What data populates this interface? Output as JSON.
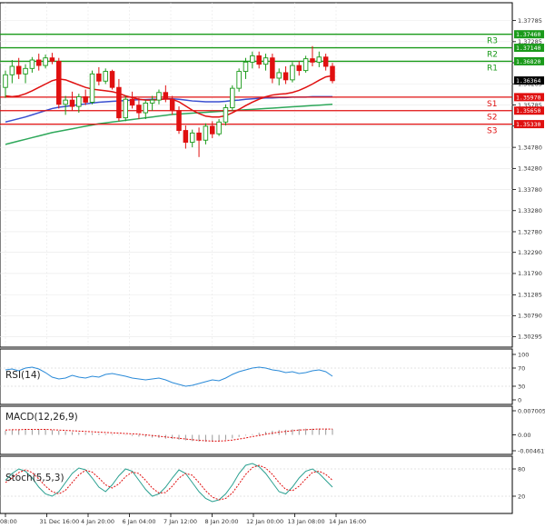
{
  "chart_data": {
    "type": "candlestick",
    "instrument_panel": {
      "y_ticks": [
        "1.37785",
        "1.37285",
        "1.36785",
        "1.36285",
        "1.35785",
        "1.35285",
        "1.34780",
        "1.34280",
        "1.33780",
        "1.33280",
        "1.32780",
        "1.32290",
        "1.31790",
        "1.31285",
        "1.30790",
        "1.30295"
      ],
      "ylim": [
        1.3013,
        1.381
      ],
      "current_price": "1.36364",
      "levels": [
        {
          "name": "R3",
          "value": 1.3746,
          "label": "1.37460",
          "color": "#1a9a1a"
        },
        {
          "name": "R2",
          "value": 1.3714,
          "label": "1.37140",
          "color": "#1a9a1a"
        },
        {
          "name": "R1",
          "value": 1.3682,
          "label": "1.36820",
          "color": "#1a9a1a"
        },
        {
          "name": "S1",
          "value": 1.3597,
          "label": "1.35970",
          "color": "#e01010"
        },
        {
          "name": "S2",
          "value": 1.3565,
          "label": "1.35650",
          "color": "#e01010"
        },
        {
          "name": "S3",
          "value": 1.3533,
          "label": "1.35330",
          "color": "#e01010"
        }
      ],
      "candles": [
        {
          "o": 1.362,
          "h": 1.366,
          "l": 1.3595,
          "c": 1.365
        },
        {
          "o": 1.365,
          "h": 1.3685,
          "l": 1.363,
          "c": 1.367
        },
        {
          "o": 1.367,
          "h": 1.369,
          "l": 1.364,
          "c": 1.3652
        },
        {
          "o": 1.3652,
          "h": 1.3675,
          "l": 1.363,
          "c": 1.3665
        },
        {
          "o": 1.3665,
          "h": 1.3692,
          "l": 1.3655,
          "c": 1.3685
        },
        {
          "o": 1.3685,
          "h": 1.37,
          "l": 1.366,
          "c": 1.3672
        },
        {
          "o": 1.3672,
          "h": 1.3698,
          "l": 1.3665,
          "c": 1.369
        },
        {
          "o": 1.369,
          "h": 1.3702,
          "l": 1.3675,
          "c": 1.3682
        },
        {
          "o": 1.3682,
          "h": 1.369,
          "l": 1.357,
          "c": 1.358
        },
        {
          "o": 1.358,
          "h": 1.36,
          "l": 1.3555,
          "c": 1.359
        },
        {
          "o": 1.359,
          "h": 1.361,
          "l": 1.3565,
          "c": 1.3575
        },
        {
          "o": 1.3575,
          "h": 1.3605,
          "l": 1.356,
          "c": 1.3598
        },
        {
          "o": 1.3598,
          "h": 1.3615,
          "l": 1.3578,
          "c": 1.3585
        },
        {
          "o": 1.3585,
          "h": 1.366,
          "l": 1.358,
          "c": 1.3652
        },
        {
          "o": 1.3652,
          "h": 1.3668,
          "l": 1.3625,
          "c": 1.3635
        },
        {
          "o": 1.3635,
          "h": 1.3665,
          "l": 1.3628,
          "c": 1.3658
        },
        {
          "o": 1.3658,
          "h": 1.3662,
          "l": 1.3615,
          "c": 1.362
        },
        {
          "o": 1.362,
          "h": 1.364,
          "l": 1.354,
          "c": 1.3548
        },
        {
          "o": 1.3548,
          "h": 1.36,
          "l": 1.354,
          "c": 1.3592
        },
        {
          "o": 1.3592,
          "h": 1.361,
          "l": 1.357,
          "c": 1.3578
        },
        {
          "o": 1.3578,
          "h": 1.3595,
          "l": 1.3545,
          "c": 1.356
        },
        {
          "o": 1.356,
          "h": 1.359,
          "l": 1.3545,
          "c": 1.3583
        },
        {
          "o": 1.3583,
          "h": 1.36,
          "l": 1.3565,
          "c": 1.359
        },
        {
          "o": 1.359,
          "h": 1.3615,
          "l": 1.358,
          "c": 1.3608
        },
        {
          "o": 1.3608,
          "h": 1.3625,
          "l": 1.3585,
          "c": 1.3592
        },
        {
          "o": 1.3592,
          "h": 1.36,
          "l": 1.3555,
          "c": 1.3565
        },
        {
          "o": 1.3565,
          "h": 1.3575,
          "l": 1.351,
          "c": 1.3518
        },
        {
          "o": 1.3518,
          "h": 1.353,
          "l": 1.3475,
          "c": 1.349
        },
        {
          "o": 1.349,
          "h": 1.352,
          "l": 1.3478,
          "c": 1.3512
        },
        {
          "o": 1.3512,
          "h": 1.3525,
          "l": 1.3455,
          "c": 1.3495
        },
        {
          "o": 1.3495,
          "h": 1.3535,
          "l": 1.3485,
          "c": 1.3528
        },
        {
          "o": 1.3528,
          "h": 1.354,
          "l": 1.35,
          "c": 1.351
        },
        {
          "o": 1.351,
          "h": 1.3545,
          "l": 1.3505,
          "c": 1.3538
        },
        {
          "o": 1.3538,
          "h": 1.358,
          "l": 1.353,
          "c": 1.3572
        },
        {
          "o": 1.3572,
          "h": 1.3625,
          "l": 1.3565,
          "c": 1.3618
        },
        {
          "o": 1.3618,
          "h": 1.3665,
          "l": 1.361,
          "c": 1.3658
        },
        {
          "o": 1.3658,
          "h": 1.369,
          "l": 1.364,
          "c": 1.368
        },
        {
          "o": 1.368,
          "h": 1.3705,
          "l": 1.3665,
          "c": 1.3695
        },
        {
          "o": 1.3695,
          "h": 1.3705,
          "l": 1.3665,
          "c": 1.3675
        },
        {
          "o": 1.3675,
          "h": 1.37,
          "l": 1.366,
          "c": 1.369
        },
        {
          "o": 1.369,
          "h": 1.37,
          "l": 1.363,
          "c": 1.3642
        },
        {
          "o": 1.3642,
          "h": 1.3665,
          "l": 1.3625,
          "c": 1.3655
        },
        {
          "o": 1.3655,
          "h": 1.367,
          "l": 1.3628,
          "c": 1.3638
        },
        {
          "o": 1.3638,
          "h": 1.368,
          "l": 1.3632,
          "c": 1.3672
        },
        {
          "o": 1.3672,
          "h": 1.3682,
          "l": 1.3648,
          "c": 1.366
        },
        {
          "o": 1.366,
          "h": 1.3695,
          "l": 1.3655,
          "c": 1.3688
        },
        {
          "o": 1.3688,
          "h": 1.3718,
          "l": 1.367,
          "c": 1.368
        },
        {
          "o": 1.368,
          "h": 1.3705,
          "l": 1.3668,
          "c": 1.3692
        },
        {
          "o": 1.3692,
          "h": 1.37,
          "l": 1.366,
          "c": 1.367
        },
        {
          "o": 1.367,
          "h": 1.3678,
          "l": 1.363,
          "c": 1.3636
        }
      ],
      "ma_fast": [
        1.36,
        1.3598,
        1.36,
        1.3605,
        1.3612,
        1.362,
        1.3628,
        1.3636,
        1.364,
        1.3638,
        1.3632,
        1.3626,
        1.362,
        1.3616,
        1.3614,
        1.3612,
        1.361,
        1.3606,
        1.36,
        1.3596,
        1.3592,
        1.359,
        1.359,
        1.3591,
        1.3593,
        1.3592,
        1.3586,
        1.3576,
        1.3566,
        1.3558,
        1.3552,
        1.355,
        1.355,
        1.3553,
        1.356,
        1.3568,
        1.3577,
        1.3585,
        1.3592,
        1.3598,
        1.3602,
        1.3604,
        1.3605,
        1.3608,
        1.3613,
        1.362,
        1.3628,
        1.3637,
        1.3645,
        1.3648
      ],
      "ma_mid": [
        1.3538,
        1.3542,
        1.3546,
        1.355,
        1.3555,
        1.356,
        1.3565,
        1.357,
        1.3573,
        1.3575,
        1.3577,
        1.3579,
        1.3581,
        1.3583,
        1.3585,
        1.3586,
        1.3587,
        1.3588,
        1.3589,
        1.359,
        1.3591,
        1.3591,
        1.3592,
        1.3592,
        1.3593,
        1.3593,
        1.3592,
        1.359,
        1.3588,
        1.3587,
        1.3586,
        1.3586,
        1.3586,
        1.3587,
        1.3589,
        1.359,
        1.3592,
        1.3593,
        1.3594,
        1.3595,
        1.3595,
        1.3596,
        1.3596,
        1.3597,
        1.3597,
        1.3597,
        1.3598,
        1.3598,
        1.3598,
        1.3598
      ],
      "ma_slow": [
        1.3485,
        1.3489,
        1.3493,
        1.3497,
        1.3501,
        1.3505,
        1.3509,
        1.3513,
        1.3516,
        1.3519,
        1.3522,
        1.3525,
        1.3528,
        1.3531,
        1.3534,
        1.3536,
        1.3538,
        1.354,
        1.3542,
        1.3544,
        1.3546,
        1.3548,
        1.355,
        1.3552,
        1.3554,
        1.3556,
        1.3557,
        1.3558,
        1.3559,
        1.356,
        1.3561,
        1.3562,
        1.3563,
        1.3564,
        1.3565,
        1.3566,
        1.3567,
        1.3568,
        1.3569,
        1.357,
        1.3571,
        1.3572,
        1.3573,
        1.3574,
        1.3575,
        1.3576,
        1.3577,
        1.3578,
        1.3579,
        1.358
      ],
      "colors": {
        "bull": "#1a9a1a",
        "bear": "#e01010",
        "ma_fast": "#e01010",
        "ma_mid": "#3a4fd0",
        "ma_slow": "#2ea85a",
        "price_badge": "#000000"
      }
    },
    "rsi_panel": {
      "label": "RSI(14)",
      "y_ticks": [
        "100",
        "70",
        "30",
        "0"
      ],
      "ylim": [
        0,
        100
      ],
      "values": [
        66,
        68,
        64,
        70,
        72,
        68,
        60,
        50,
        46,
        48,
        54,
        50,
        48,
        52,
        50,
        56,
        58,
        55,
        52,
        48,
        46,
        44,
        46,
        48,
        44,
        38,
        34,
        30,
        32,
        36,
        40,
        44,
        42,
        48,
        56,
        62,
        66,
        70,
        72,
        70,
        66,
        64,
        60,
        62,
        58,
        60,
        64,
        66,
        62,
        52
      ],
      "color": "#2a8ad8"
    },
    "macd_panel": {
      "label": "MACD(12,26,9)",
      "y_ticks": [
        "0.007005",
        "0.00",
        "-0.004617"
      ],
      "ylim": [
        -0.004617,
        0.007005
      ],
      "histogram": [
        0.0012,
        0.0014,
        0.0015,
        0.0016,
        0.0017,
        0.0017,
        0.0016,
        0.0014,
        0.0012,
        0.001,
        0.0008,
        0.0007,
        0.0006,
        0.0005,
        0.0004,
        0.0003,
        0.0002,
        0.0001,
        -0.0001,
        -0.0003,
        -0.0005,
        -0.0006,
        -0.0008,
        -0.0009,
        -0.0011,
        -0.0012,
        -0.0014,
        -0.0016,
        -0.0018,
        -0.0019,
        -0.002,
        -0.0019,
        -0.0017,
        -0.0014,
        -0.001,
        -0.0006,
        -0.0002,
        0.0002,
        0.0006,
        0.0009,
        0.0012,
        0.0014,
        0.0015,
        0.0016,
        0.0017,
        0.0018,
        0.0018,
        0.0018,
        0.0018,
        0.0017
      ],
      "signal": [
        0.0014,
        0.0015,
        0.0015,
        0.0016,
        0.0016,
        0.0016,
        0.0016,
        0.0015,
        0.0014,
        0.0013,
        0.0012,
        0.0011,
        0.001,
        0.0009,
        0.0008,
        0.0007,
        0.0006,
        0.0005,
        0.0004,
        0.0003,
        0.0002,
        0.0,
        -0.0002,
        -0.0004,
        -0.0006,
        -0.0008,
        -0.001,
        -0.0012,
        -0.0014,
        -0.0016,
        -0.0017,
        -0.0018,
        -0.0018,
        -0.0017,
        -0.0015,
        -0.0012,
        -0.0009,
        -0.0005,
        -0.0002,
        0.0002,
        0.0005,
        0.0008,
        0.001,
        0.0012,
        0.0014,
        0.0015,
        0.0016,
        0.0017,
        0.0017,
        0.0017
      ],
      "colors": {
        "histogram": "#999999",
        "signal": "#e01010"
      }
    },
    "stoch_panel": {
      "label": "Stoch(5,5,3)",
      "y_ticks": [
        "80",
        "20"
      ],
      "ylim": [
        0,
        100
      ],
      "main": [
        55,
        70,
        80,
        75,
        60,
        40,
        25,
        20,
        30,
        50,
        70,
        82,
        78,
        60,
        40,
        30,
        45,
        65,
        80,
        75,
        55,
        35,
        20,
        25,
        40,
        60,
        78,
        70,
        50,
        30,
        15,
        8,
        12,
        25,
        45,
        70,
        88,
        92,
        85,
        70,
        50,
        30,
        25,
        40,
        60,
        75,
        80,
        70,
        55,
        40
      ],
      "signal": [
        50,
        60,
        72,
        78,
        72,
        58,
        42,
        30,
        25,
        33,
        50,
        67,
        77,
        73,
        60,
        45,
        38,
        47,
        63,
        73,
        70,
        55,
        38,
        27,
        28,
        42,
        60,
        70,
        66,
        50,
        32,
        18,
        12,
        15,
        27,
        47,
        68,
        83,
        88,
        82,
        68,
        50,
        35,
        32,
        42,
        58,
        72,
        75,
        68,
        55
      ],
      "colors": {
        "main": "#2aa090",
        "signal": "#e01010"
      }
    },
    "x_ticks": [
      "08:00",
      "31 Dec 16:00",
      "4 Jan 20:00",
      "6 Jan 04:00",
      "7 Jan 12:00",
      "8 Jan 20:00",
      "12 Jan 00:00",
      "13 Jan 08:00",
      "14 Jan 16:00"
    ],
    "grid": true
  }
}
